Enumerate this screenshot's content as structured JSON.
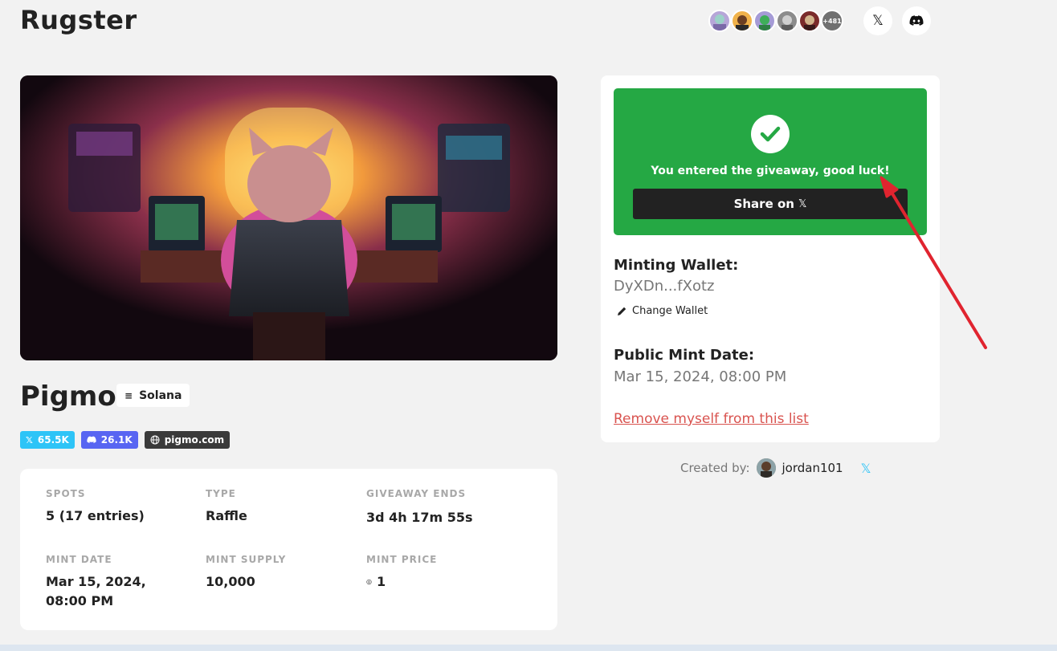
{
  "header": {
    "brand": "Rugster",
    "participants_more": "+481",
    "x_icon": "x-icon",
    "discord_icon": "discord-icon"
  },
  "project": {
    "name": "Pigmo",
    "chain": "Solana",
    "badges": {
      "twitter": "65.5K",
      "discord": "26.1K",
      "website": "pigmo.com"
    }
  },
  "stats": {
    "spots_label": "SPOTS",
    "spots_value": "5 (17 entries)",
    "type_label": "TYPE",
    "type_value": "Raffle",
    "ends_label": "GIVEAWAY ENDS",
    "ends_value": "3d 4h 17m 55s",
    "mint_date_label": "MINT DATE",
    "mint_date_value": "Mar 15, 2024, 08:00 PM",
    "mint_supply_label": "MINT SUPPLY",
    "mint_supply_value": "10,000",
    "mint_price_label": "MINT PRICE",
    "mint_price_value": "1"
  },
  "panel": {
    "success_message": "You entered the giveaway, good luck!",
    "share_label": "Share on",
    "minting_wallet_label": "Minting Wallet:",
    "minting_wallet_value": "DyXDn...fXotz",
    "change_wallet_label": "Change Wallet",
    "public_mint_label": "Public Mint Date:",
    "public_mint_value": "Mar 15, 2024, 08:00 PM",
    "remove_label": "Remove myself from this list"
  },
  "creator": {
    "label": "Created by:",
    "name": "jordan101"
  },
  "colors": {
    "success": "#25a844",
    "twitter": "#2ec4f7",
    "discord": "#5865f2",
    "danger": "#d9534f",
    "annotation_arrow": "#e0242f"
  }
}
